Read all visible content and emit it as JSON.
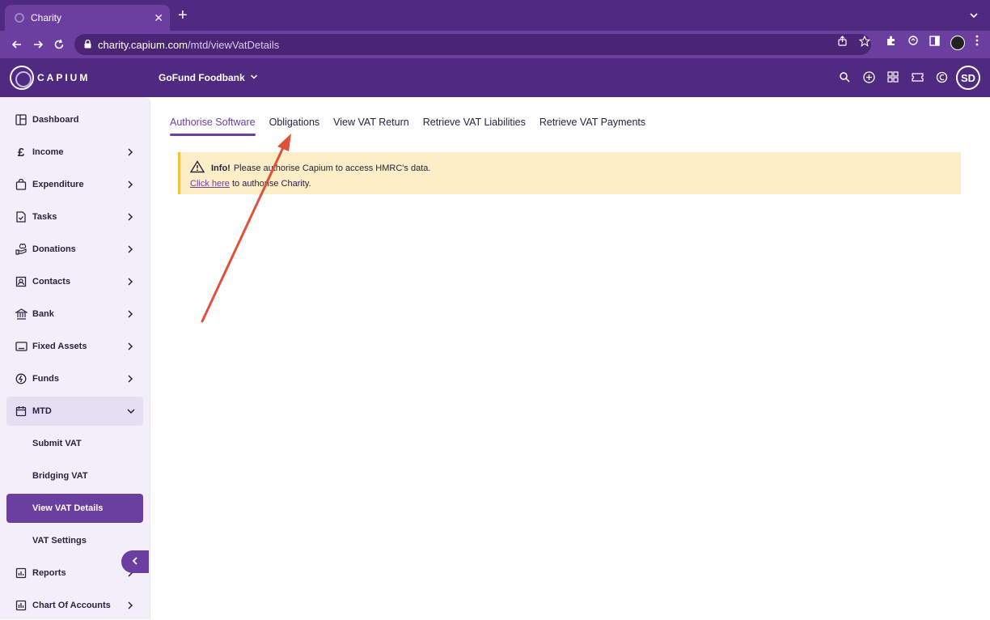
{
  "browser": {
    "tab_title": "Charity",
    "url_domain": "charity.capium.com",
    "url_path": "/mtd/viewVatDetails"
  },
  "header": {
    "logo_text": "CAPIUM",
    "org_name": "GoFund Foodbank",
    "avatar_initials": "SD"
  },
  "sidebar": {
    "items": [
      {
        "label": "Dashboard",
        "icon": "dashboard-icon"
      },
      {
        "label": "Income",
        "icon": "pound-icon"
      },
      {
        "label": "Expenditure",
        "icon": "bag-icon"
      },
      {
        "label": "Tasks",
        "icon": "task-icon"
      },
      {
        "label": "Donations",
        "icon": "donation-icon"
      },
      {
        "label": "Contacts",
        "icon": "contact-icon"
      },
      {
        "label": "Bank",
        "icon": "bank-icon"
      },
      {
        "label": "Fixed Assets",
        "icon": "monitor-icon"
      },
      {
        "label": "Funds",
        "icon": "funds-icon"
      },
      {
        "label": "MTD",
        "icon": "calendar-icon"
      },
      {
        "label": "Submit VAT"
      },
      {
        "label": "Bridging VAT"
      },
      {
        "label": "View VAT Details"
      },
      {
        "label": "VAT Settings"
      },
      {
        "label": "Reports",
        "icon": "report-icon"
      },
      {
        "label": "Chart Of Accounts",
        "icon": "chart-icon"
      }
    ]
  },
  "main": {
    "tabs": [
      {
        "label": "Authorise Software"
      },
      {
        "label": "Obligations"
      },
      {
        "label": "View VAT Return"
      },
      {
        "label": "Retrieve VAT Liabilities"
      },
      {
        "label": "Retrieve VAT Payments"
      }
    ],
    "alert": {
      "title": "Info!",
      "message": "Please authorise Capium to access HMRC's data.",
      "link_text": "Click here",
      "link_suffix": "to authorise Charity."
    }
  },
  "colors": {
    "brand": "#4f2a80",
    "accent": "#6a3fa0",
    "alert_bg": "#fcefc7",
    "annotation_arrow": "#e0513a"
  }
}
